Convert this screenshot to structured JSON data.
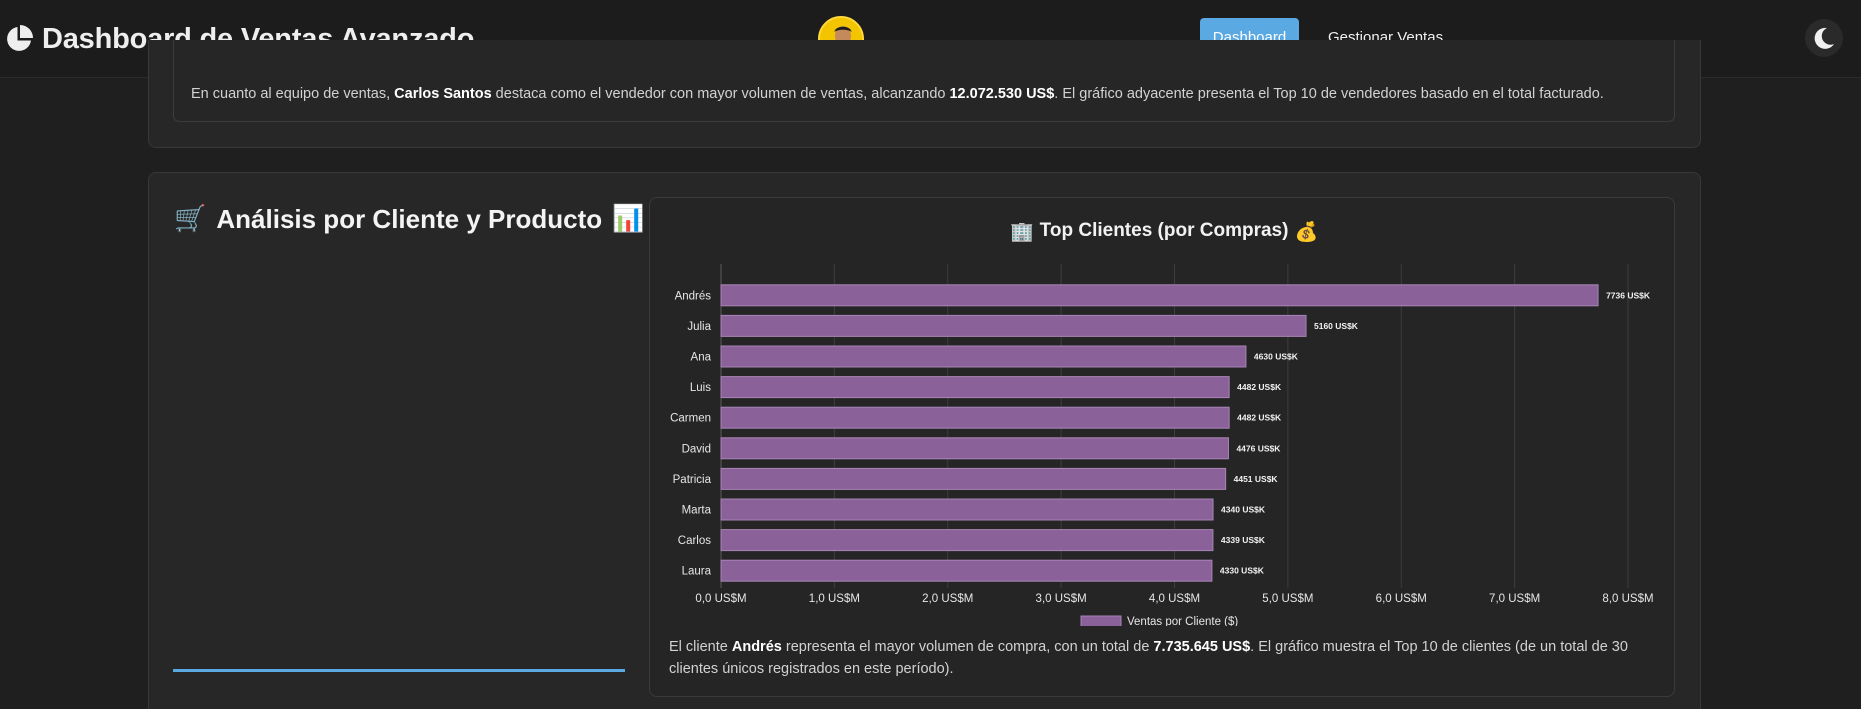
{
  "navbar": {
    "brand_icon": "pie-chart-icon",
    "title": "Dashboard de Ventas Avanzado",
    "avatar": "user-avatar",
    "links": {
      "dashboard": "Dashboard",
      "ventas": "Gestionar Ventas"
    },
    "theme_toggle_icon": "moon-icon",
    "accent": "#5aa9e3"
  },
  "vendedores_summary": {
    "prefix": "En cuanto al equipo de ventas, ",
    "name": "Carlos Santos",
    "middle": " destaca como el vendedor con mayor volumen de ventas, alcanzando ",
    "amount": "12.072.530 US$",
    "suffix": ". El gráfico adyacente presenta el Top 10 de vendedores basado en el total facturado."
  },
  "section": {
    "emoji_left": "🛒",
    "title": "Análisis por Cliente y Producto",
    "emoji_right": "📊"
  },
  "chart_header": {
    "emoji_left": "🏢",
    "title": "Top Clientes (por Compras)",
    "emoji_right": "💰"
  },
  "chart_data": {
    "type": "bar",
    "orientation": "horizontal",
    "categories": [
      "Andrés",
      "Julia",
      "Ana",
      "Luis",
      "Carmen",
      "David",
      "Patricia",
      "Marta",
      "Carlos",
      "Laura"
    ],
    "values": [
      7736,
      5160,
      4630,
      4482,
      4482,
      4476,
      4451,
      4340,
      4339,
      4330
    ],
    "data_labels": [
      "7736 US$K",
      "5160 US$K",
      "4630 US$K",
      "4482 US$K",
      "4482 US$K",
      "4476 US$K",
      "4451 US$K",
      "4340 US$K",
      "4339 US$K",
      "4330 US$K"
    ],
    "x_ticks": [
      "0,0 US$M",
      "1,0 US$M",
      "2,0 US$M",
      "3,0 US$M",
      "4,0 US$M",
      "5,0 US$M",
      "6,0 US$M",
      "7,0 US$M",
      "8,0 US$M"
    ],
    "xlim": [
      0,
      8000
    ],
    "series_name": "Ventas por Cliente ($)",
    "legend_position": "bottom",
    "grid": true,
    "bar_color": "#8a6299"
  },
  "chart_summary": {
    "prefix": "El cliente ",
    "name": "Andrés",
    "middle": " representa el mayor volumen de compra, con un total de ",
    "amount": "7.735.645 US$",
    "suffix": ". El gráfico muestra el Top 10 de clientes (de un total de 30 clientes únicos registrados en este período)."
  }
}
